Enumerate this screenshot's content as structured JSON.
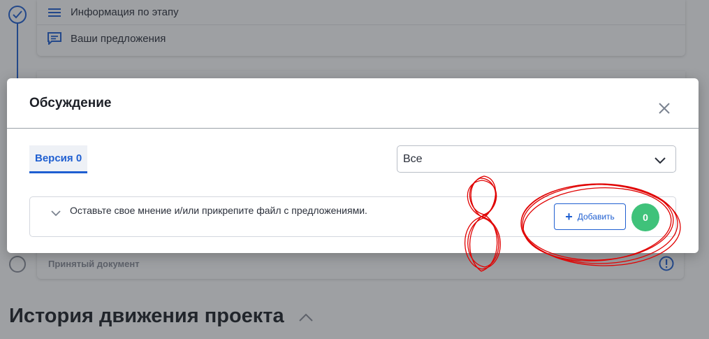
{
  "background": {
    "menu_items": [
      {
        "label": "Информация по этапу",
        "icon": "menu-lines-icon"
      },
      {
        "label": "Ваши предложения",
        "icon": "comment-icon"
      }
    ],
    "accepted_document_label": "Принятый документ",
    "history_title": "История движения проекта"
  },
  "modal": {
    "title": "Обсуждение",
    "tabs": [
      {
        "label": "Версия 0",
        "active": true
      }
    ],
    "filter": {
      "selected": "Все"
    },
    "comment_prompt": "Оставьте свое мнение и/или прикрепите файл с предложениями.",
    "add_button_label": "Добавить",
    "count": "0"
  },
  "colors": {
    "accent": "#1f5fd1",
    "badge": "#3fc27a",
    "annotation": "#e00000"
  }
}
